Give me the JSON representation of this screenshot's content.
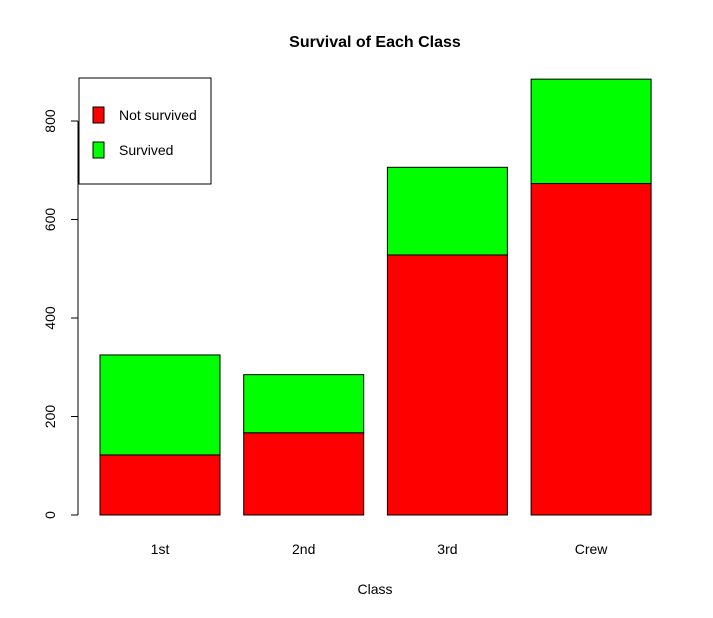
{
  "chart_data": {
    "type": "bar",
    "stacked": true,
    "title": "Survival of Each Class",
    "xlabel": "Class",
    "ylabel": "",
    "categories": [
      "1st",
      "2nd",
      "3rd",
      "Crew"
    ],
    "series": [
      {
        "name": "Not survived",
        "color": "#ff0000",
        "values": [
          122,
          167,
          528,
          673
        ]
      },
      {
        "name": "Survived",
        "color": "#00ff00",
        "values": [
          203,
          118,
          178,
          212
        ]
      }
    ],
    "ylim": [
      0,
      885
    ],
    "yticks": [
      0,
      200,
      400,
      600,
      800
    ],
    "grid": false,
    "legend": {
      "position": "top-left",
      "entries": [
        "Not survived",
        "Survived"
      ]
    }
  }
}
